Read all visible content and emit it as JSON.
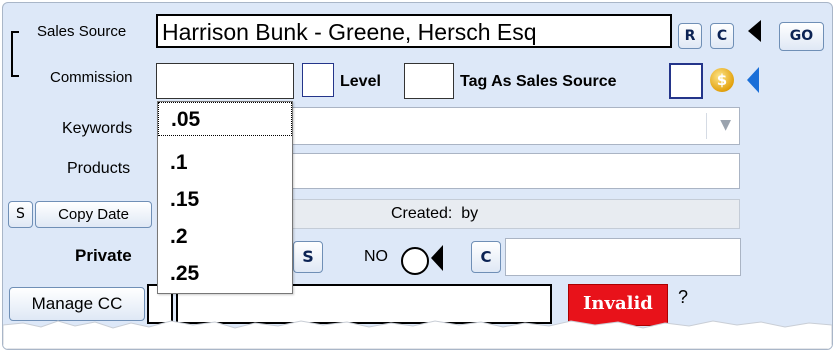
{
  "sales_source": {
    "label": "Sales Source",
    "value": "Harrison Bunk - Greene, Hersch Esq",
    "r_button": "R",
    "c_button": "C",
    "go_button": "GO"
  },
  "commission": {
    "label": "Commission",
    "value": "",
    "level_label": "Level",
    "level_value": "",
    "tag_as_label": "Tag As Sales Source",
    "coin_glyph": "$"
  },
  "commission_options": [
    ".05",
    ".1",
    ".15",
    ".2",
    ".25"
  ],
  "keywords": {
    "label": "Keywords",
    "arrow": "▼"
  },
  "products": {
    "label": "Products"
  },
  "date_row": {
    "s_button": "S",
    "copy_date_button": "Copy Date",
    "created_text": "Created:  by"
  },
  "private_row": {
    "label": "Private",
    "s_button": "S",
    "no_label": "NO",
    "c_button": "C"
  },
  "manage_row": {
    "manage_cc_button": "Manage CC",
    "invalid_label": "Invalid",
    "question_mark": "?"
  },
  "colors": {
    "background": "#dde8f8",
    "checkbox_border": "#24358a",
    "invalid_red": "#e8121a",
    "arrow_blue": "#1a6fd8"
  }
}
